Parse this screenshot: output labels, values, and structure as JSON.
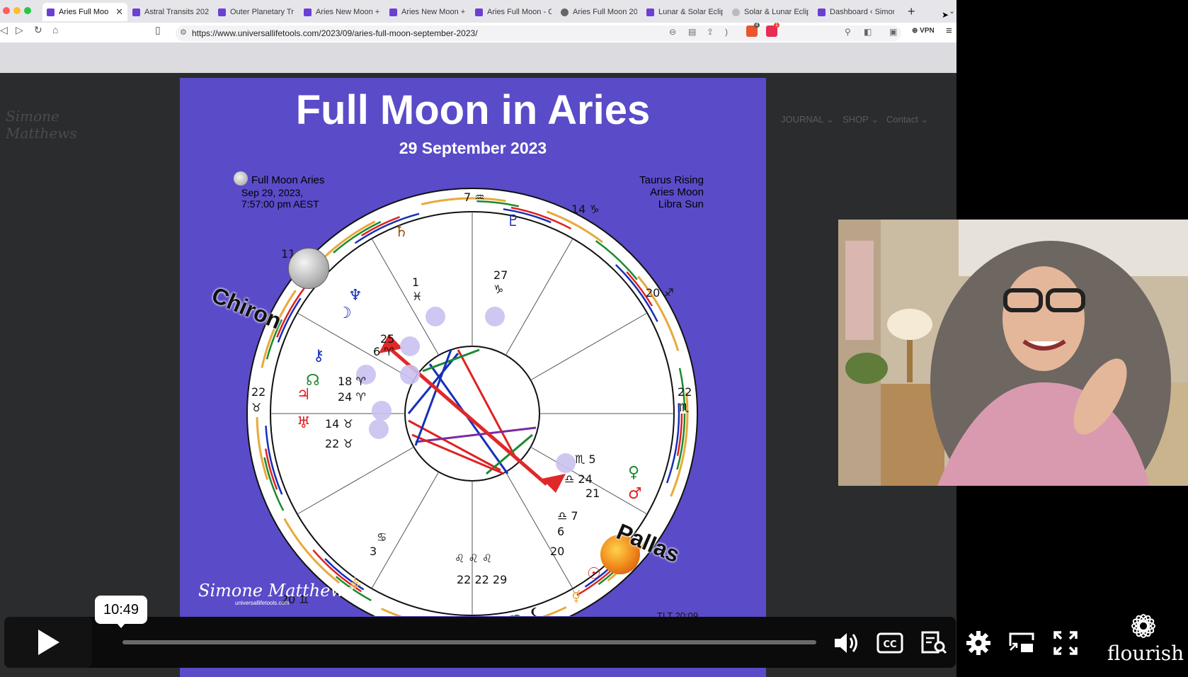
{
  "browser": {
    "tabs": [
      {
        "label": "Aries Full Moo",
        "active": true
      },
      {
        "label": "Astral Transits 202"
      },
      {
        "label": "Outer Planetary Tr"
      },
      {
        "label": "Aries New Moon +"
      },
      {
        "label": "Aries New Moon +"
      },
      {
        "label": "Aries Full Moon - C"
      },
      {
        "label": "Aries Full Moon 20"
      },
      {
        "label": "Lunar & Solar Eclip"
      },
      {
        "label": "Solar & Lunar Eclip"
      },
      {
        "label": "Dashboard ‹ Simor"
      }
    ],
    "close_glyph": "✕",
    "new_tab": "+",
    "url": "https://www.universallifetools.com/2023/09/aries-full-moon-september-2023/",
    "vpn": "⊕ VPN",
    "brave_badge": "4",
    "rewards_badge": "1"
  },
  "site": {
    "logo": "Simone Matthews",
    "nav": [
      "JOURNAL ⌄",
      "SHOP ⌄",
      "Contact ⌄"
    ]
  },
  "chart": {
    "title": "Full Moon in Aries",
    "date": "29 September 2023",
    "info_left": [
      "Full Moon Aries",
      "Sep 29, 2023,",
      "7:57:00 pm AEST"
    ],
    "info_right": [
      "Taurus Rising",
      "Aries Moon",
      "Libra Sun"
    ],
    "labels": {
      "chiron": "Chiron",
      "pallas": "Pallas"
    },
    "signature": "Simone Matthews",
    "signature_sub": "universallifetools.com",
    "tlt": "TLT 20:09"
  },
  "video": {
    "timecode": "10:49",
    "progress": 0.0,
    "brand": "flourish"
  },
  "colors": {
    "chart_bg": "#5a4bc8",
    "site_bg": "#2b2c2e",
    "tab_favicon": "#6b3fd4"
  }
}
